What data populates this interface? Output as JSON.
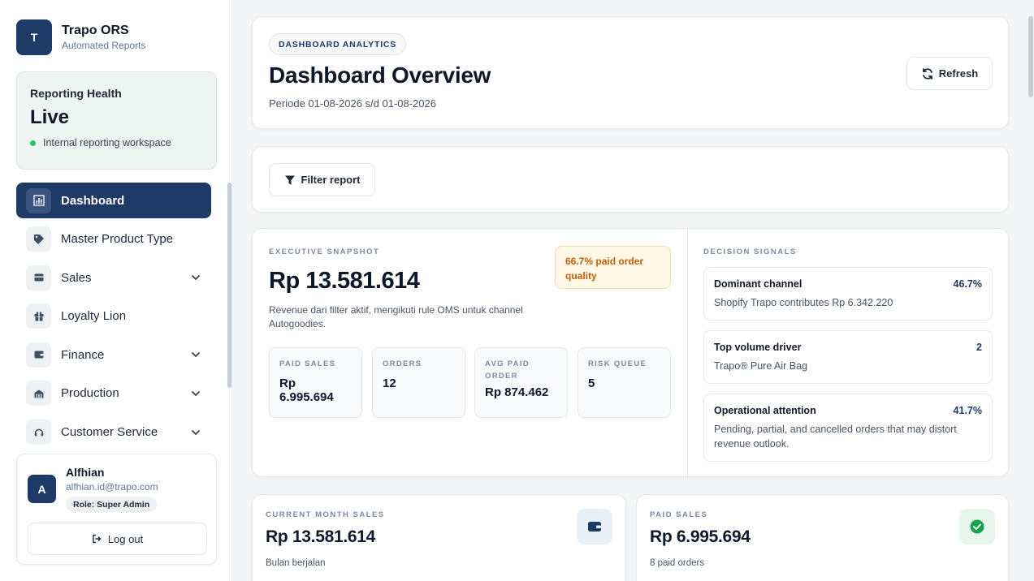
{
  "brand": {
    "logo_letter": "T",
    "name": "Trapo ORS",
    "subtitle": "Automated Reports"
  },
  "health": {
    "title": "Reporting Health",
    "status": "Live",
    "subtitle": "Internal reporting workspace",
    "status_color": "#22c55e"
  },
  "nav": {
    "items": [
      {
        "label": "Dashboard",
        "icon": "chart-icon",
        "active": true,
        "expandable": false
      },
      {
        "label": "Master Product Type",
        "icon": "tag-icon",
        "active": false,
        "expandable": false
      },
      {
        "label": "Sales",
        "icon": "card-icon",
        "active": false,
        "expandable": true
      },
      {
        "label": "Loyalty Lion",
        "icon": "gift-icon",
        "active": false,
        "expandable": false
      },
      {
        "label": "Finance",
        "icon": "wallet-icon",
        "active": false,
        "expandable": true
      },
      {
        "label": "Production",
        "icon": "factory-icon",
        "active": false,
        "expandable": true
      },
      {
        "label": "Customer Service",
        "icon": "headset-icon",
        "active": false,
        "expandable": true
      }
    ]
  },
  "user": {
    "initial": "A",
    "name": "Alfhian",
    "email": "alfhian.id@trapo.com",
    "role": "Role: Super Admin",
    "logout_label": "Log out"
  },
  "header": {
    "tag": "DASHBOARD ANALYTICS",
    "title": "Dashboard Overview",
    "period": "Periode 01-08-2026 s/d 01-08-2026",
    "refresh_label": "Refresh"
  },
  "filter": {
    "button_label": "Filter report"
  },
  "snapshot": {
    "eyebrow": "EXECUTIVE SNAPSHOT",
    "value": "Rp 13.581.614",
    "description": "Revenue dari filter aktif, mengikuti rule OMS untuk channel Autogoodies.",
    "quality_badge": "66.7% paid order quality",
    "metrics": [
      {
        "label": "PAID SALES",
        "value": "Rp 6.995.694"
      },
      {
        "label": "ORDERS",
        "value": "12"
      },
      {
        "label": "AVG PAID ORDER",
        "value": "Rp 874.462"
      },
      {
        "label": "RISK QUEUE",
        "value": "5"
      }
    ]
  },
  "signals": {
    "eyebrow": "DECISION SIGNALS",
    "items": [
      {
        "title": "Dominant channel",
        "value": "46.7%",
        "description": "Shopify Trapo contributes Rp 6.342.220"
      },
      {
        "title": "Top volume driver",
        "value": "2",
        "description": "Trapo® Pure Air Bag"
      },
      {
        "title": "Operational attention",
        "value": "41.7%",
        "description": "Pending, partial, and cancelled orders that may distort revenue outlook."
      }
    ]
  },
  "stats": [
    {
      "eyebrow": "CURRENT MONTH SALES",
      "value": "Rp 13.581.614",
      "subtitle": "Bulan berjalan",
      "icon": "wallet-icon",
      "icon_bg": "#eaf0f7"
    },
    {
      "eyebrow": "PAID SALES",
      "value": "Rp 6.995.694",
      "subtitle": "8 paid orders",
      "icon": "check-circle-icon",
      "icon_bg": "#e6f6ec"
    }
  ],
  "colors": {
    "primary": "#1e3a66",
    "warning_text": "#c25e0b",
    "success": "#22c55e"
  }
}
